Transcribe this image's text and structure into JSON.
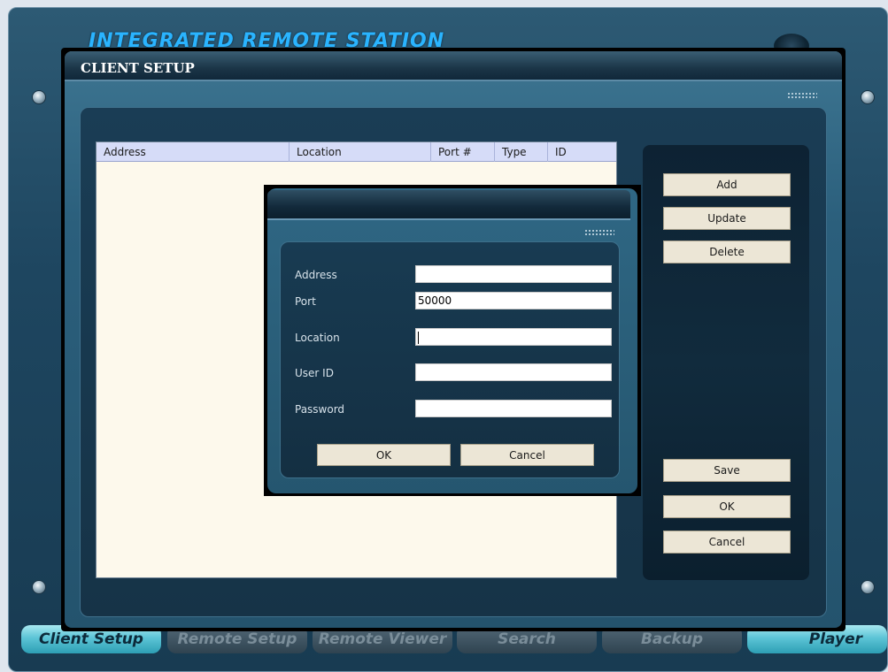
{
  "app": {
    "title": "INTEGRATED REMOTE STATION"
  },
  "tabs": [
    {
      "label": "Client Setup",
      "active": true
    },
    {
      "label": "Remote Setup",
      "active": false
    },
    {
      "label": "Remote Viewer",
      "active": false
    },
    {
      "label": "Search",
      "active": false
    },
    {
      "label": "Backup",
      "active": false
    },
    {
      "label": "Player",
      "active": true
    }
  ],
  "dialog": {
    "title": "CLIENT SETUP",
    "list_columns": [
      "Address",
      "Location",
      "Port #",
      "Type",
      "ID"
    ],
    "buttons": {
      "add": "Add",
      "update": "Update",
      "delete": "Delete",
      "save": "Save",
      "ok": "OK",
      "cancel": "Cancel"
    }
  },
  "modal": {
    "fields": [
      {
        "label": "Address",
        "value": ""
      },
      {
        "label": "Port",
        "value": "50000"
      },
      {
        "label": "Location",
        "value": ""
      },
      {
        "label": "User ID",
        "value": ""
      },
      {
        "label": "Password",
        "value": ""
      }
    ],
    "buttons": {
      "ok": "OK",
      "cancel": "Cancel"
    }
  },
  "colors": {
    "accent": "#2ab4ff",
    "list_background": "#fdf9ec",
    "list_header": "#d6dcf8",
    "button_face": "#ece6d6"
  }
}
